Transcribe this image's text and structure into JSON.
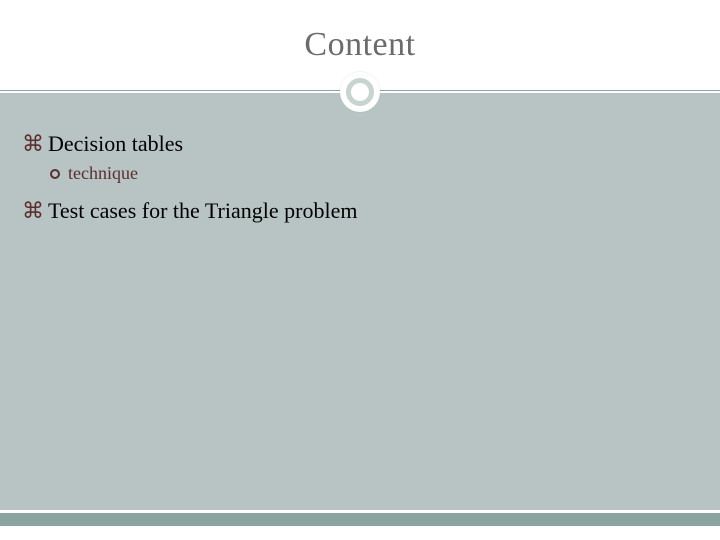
{
  "slide": {
    "title": "Content",
    "bullets": [
      {
        "level": 1,
        "text": "Decision tables"
      },
      {
        "level": 2,
        "text": "technique"
      },
      {
        "level": 1,
        "text": "Test cases for the Triangle problem"
      }
    ]
  },
  "theme": {
    "accent": "#8aa5a0",
    "body_bg": "#b7c4c3",
    "bullet_color": "#5b2e2e",
    "title_color": "#6b6b6b"
  }
}
